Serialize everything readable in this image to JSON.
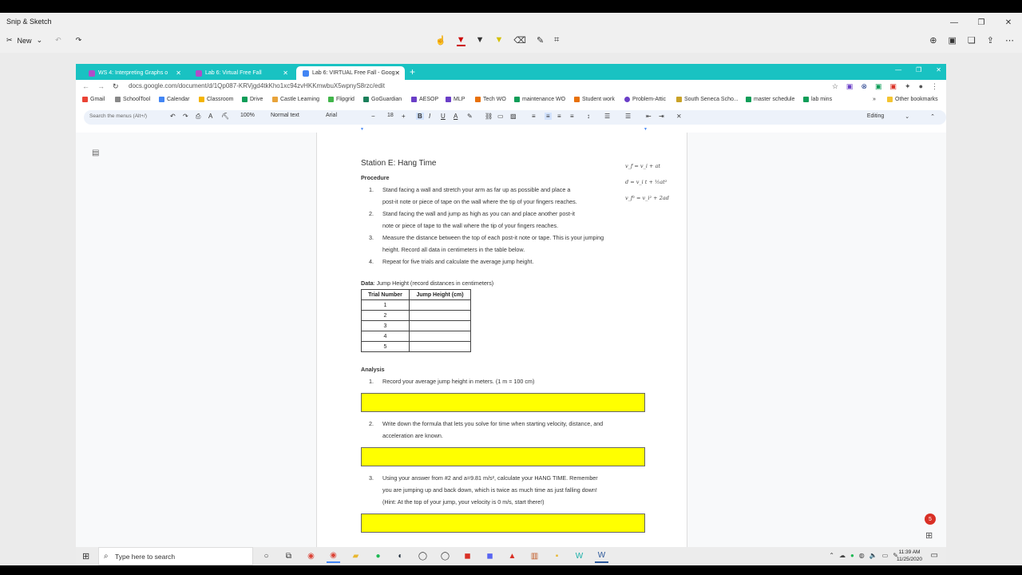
{
  "snip": {
    "title": "Snip & Sketch",
    "new_label": "New"
  },
  "browser": {
    "tabs": [
      {
        "label": "WS 4: Interpreting Graphs o"
      },
      {
        "label": "Lab 6: Virtual Free Fall"
      },
      {
        "label": "Lab 6: VIRTUAL Free Fall - Goog"
      }
    ],
    "url": "docs.google.com/document/d/1Qp087-KRVjgd4tkKho1xc94zvHKKmwbuX5wpnyS8rzc/edit",
    "bookmarks": [
      "Gmail",
      "SchoolTool",
      "Calendar",
      "Classroom",
      "Drive",
      "Castle Learning",
      "Flipgrid",
      "GoGuardian",
      "AESOP",
      "MLP",
      "Tech WO",
      "maintenance WO",
      "Student work",
      "Problem-Attic",
      "South Seneca Scho...",
      "master schedule",
      "lab mins"
    ],
    "other_bookmarks": "Other bookmarks"
  },
  "docs_toolbar": {
    "search_placeholder": "Search the menus (Alt+/)",
    "zoom": "100%",
    "style": "Normal text",
    "font": "Arial",
    "font_size": "18",
    "mode": "Editing"
  },
  "document": {
    "heading": "Station E: Hang Time",
    "formulas": [
      "v_f = v_i + at",
      "d = v_i t + ½at²",
      "v_f² = v_i² + 2ad"
    ],
    "procedure_label": "Procedure",
    "procedure": [
      {
        "num": "1.",
        "lines": [
          "Stand facing a wall and stretch your arm as far up as possible and place a",
          "post-it note or piece of tape on the wall where the tip of your fingers reaches."
        ]
      },
      {
        "num": "2.",
        "lines": [
          "Stand facing the wall and jump as high as you can and place another post-it",
          "note or piece of tape to the wall where the tip of your fingers reaches."
        ]
      },
      {
        "num": "3.",
        "lines": [
          "Measure the distance between the top of each post-it note or tape.  This is your jumping",
          "height.  Record all data in centimeters in the table below."
        ]
      },
      {
        "num": "4.",
        "lines": [
          "Repeat for five trials and calculate the average jump height."
        ]
      }
    ],
    "data_label": "Data",
    "data_desc": ": Jump Height (record distances in centimeters)",
    "table": {
      "headers": [
        "Trial Number",
        "Jump Height (cm)"
      ],
      "rows": [
        "1",
        "2",
        "3",
        "4",
        "5"
      ]
    },
    "analysis_label": "Analysis",
    "analysis": [
      {
        "num": "1.",
        "lines": [
          "Record your average jump height in meters. (1 m = 100 cm)"
        ]
      },
      {
        "num": "2.",
        "lines": [
          "Write down the formula that lets you solve for time when starting velocity, distance, and",
          "acceleration are known."
        ]
      },
      {
        "num": "3.",
        "lines": [
          "Using your answer from #2 and a=9.81 m/s², calculate your HANG TIME. Remember",
          "you are jumping up and back down, which is twice as much time as just falling down!",
          "(Hint: At the top of your jump, your velocity is 0 m/s, start there!)"
        ]
      }
    ],
    "badge_count": "5"
  },
  "taskbar": {
    "search_placeholder": "Type here to search",
    "time": "11:39 AM",
    "date": "11/25/2020"
  },
  "colors": {
    "tabstrip": "#19c2c2",
    "answer_box": "#ffff00"
  }
}
